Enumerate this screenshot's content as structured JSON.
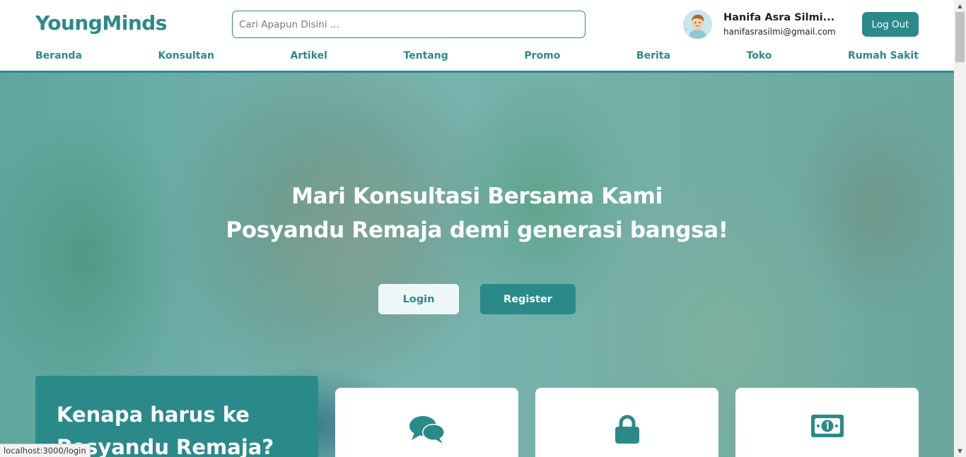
{
  "header": {
    "logo": "YoungMinds",
    "search_placeholder": "Cari Apapun Disini ...",
    "user_name": "Hanifa Asra Silmi...",
    "user_email": "hanifasrasilmi@gmail.com",
    "logout_label": "Log Out"
  },
  "nav": {
    "items": [
      "Beranda",
      "Konsultan",
      "Artikel",
      "Tentang",
      "Promo",
      "Berita",
      "Toko",
      "Rumah Sakit"
    ]
  },
  "hero": {
    "title_line1": "Mari Konsultasi Bersama Kami",
    "title_line2": "Posyandu Remaja demi generasi bangsa!",
    "login_label": "Login",
    "register_label": "Register"
  },
  "why": {
    "title_line1": "Kenapa harus ke",
    "title_line2": "Posyandu Remaja?"
  },
  "cards": [
    {
      "icon": "chat-bubbles-icon"
    },
    {
      "icon": "lock-icon"
    },
    {
      "icon": "money-icon"
    }
  ],
  "status_bar": {
    "url": "localhost:3000/login"
  },
  "colors": {
    "primary": "#2a8a8a",
    "white": "#ffffff"
  }
}
